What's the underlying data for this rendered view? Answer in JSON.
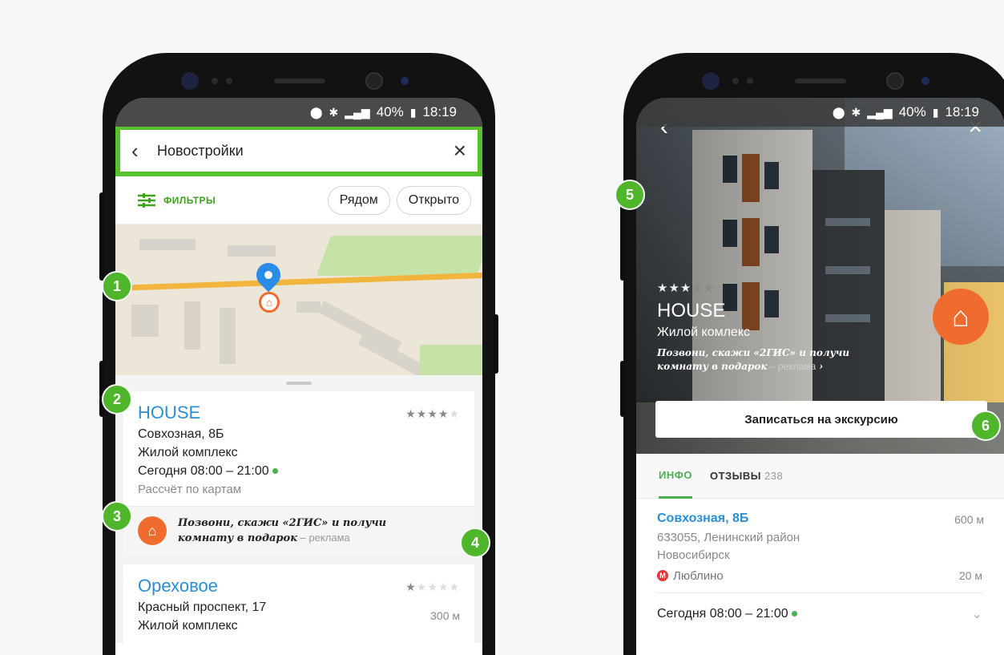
{
  "status_bar": {
    "battery": "40%",
    "time": "18:19",
    "icons": [
      "location-icon",
      "bluetooth-icon",
      "wifi-icon",
      "signal-icon",
      "battery-icon"
    ]
  },
  "left_screen": {
    "search": {
      "query": "Новостройки"
    },
    "filters": {
      "label": "ФИЛЬТРЫ",
      "chips": [
        "Рядом",
        "Открыто"
      ]
    },
    "results": [
      {
        "title": "HOUSE",
        "rating": 4,
        "rating_max": 5,
        "address": "Совхозная, 8Б",
        "type": "Жилой комплекс",
        "hours": "Сегодня 08:00 – 21:00",
        "note": "Рассчёт по картам",
        "ad": {
          "text_line1": "Позвони, скажи «2ГИС» и получи",
          "text_line2": "комнату в подарок",
          "mark": " – реклама"
        }
      },
      {
        "title": "Ореховое",
        "rating": 1,
        "rating_max": 5,
        "address": "Красный проспект, 17",
        "distance": "300 м",
        "type": "Жилой комплекс"
      }
    ]
  },
  "right_screen": {
    "rating": 3,
    "rating_max": 5,
    "title": "HOUSE",
    "subtitle": "Жилой комлекс",
    "promo_line1": "Позвони, скажи «2ГИС» и получи",
    "promo_line2": "комнату в подарок",
    "promo_mark": " – реклама",
    "cta": "Записаться на экскурсию",
    "tabs": [
      {
        "label": "ИНФО",
        "count": ""
      },
      {
        "label": "ОТЗЫВЫ",
        "count": "238"
      }
    ],
    "address": "Совхозная, 8Б",
    "address_distance": "600 м",
    "postal": "633055, Ленинский район",
    "city": "Новосибирск",
    "metro": "Люблино",
    "metro_distance": "20 м",
    "hours": "Сегодня 08:00 – 21:00"
  },
  "callouts": [
    "1",
    "2",
    "3",
    "4",
    "5",
    "6"
  ],
  "colors": {
    "green": "#4fb52b",
    "blue": "#2b8fd4",
    "orange": "#f06b2e"
  }
}
